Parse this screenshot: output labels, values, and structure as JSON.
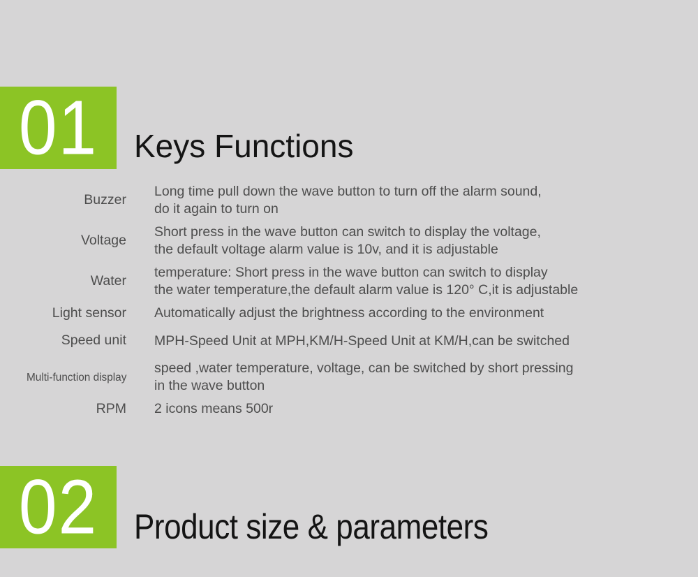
{
  "page": {
    "background_color": "#d6d5d6",
    "accent_color": "#8cc425",
    "text_color": "#4d4d4d",
    "heading_color": "#141414"
  },
  "sections": [
    {
      "number": "01",
      "title": "Keys Functions"
    },
    {
      "number": "02",
      "title": "Product size & parameters"
    }
  ],
  "specs": [
    {
      "label": "Buzzer",
      "description": "Long time pull down the wave button to turn off the alarm sound,\ndo it again to turn on"
    },
    {
      "label": "Voltage",
      "description": "Short press in the wave button can switch to display the voltage,\nthe default voltage alarm value is 10v, and it is adjustable"
    },
    {
      "label": "Water",
      "description": "temperature: Short press in the wave button can switch to display\nthe water temperature,the default alarm value is 120°  C,it is adjustable"
    },
    {
      "label": "Light sensor",
      "description": "Automatically adjust the brightness according to the environment"
    },
    {
      "label": "Speed unit",
      "description": "MPH-Speed Unit at MPH,KM/H-Speed Unit at KM/H,can be switched"
    },
    {
      "label": "Multi-function display",
      "description": "speed ,water temperature, voltage, can be switched by short pressing\nin the wave button"
    },
    {
      "label": "RPM",
      "description": "2 icons means 500r"
    }
  ]
}
